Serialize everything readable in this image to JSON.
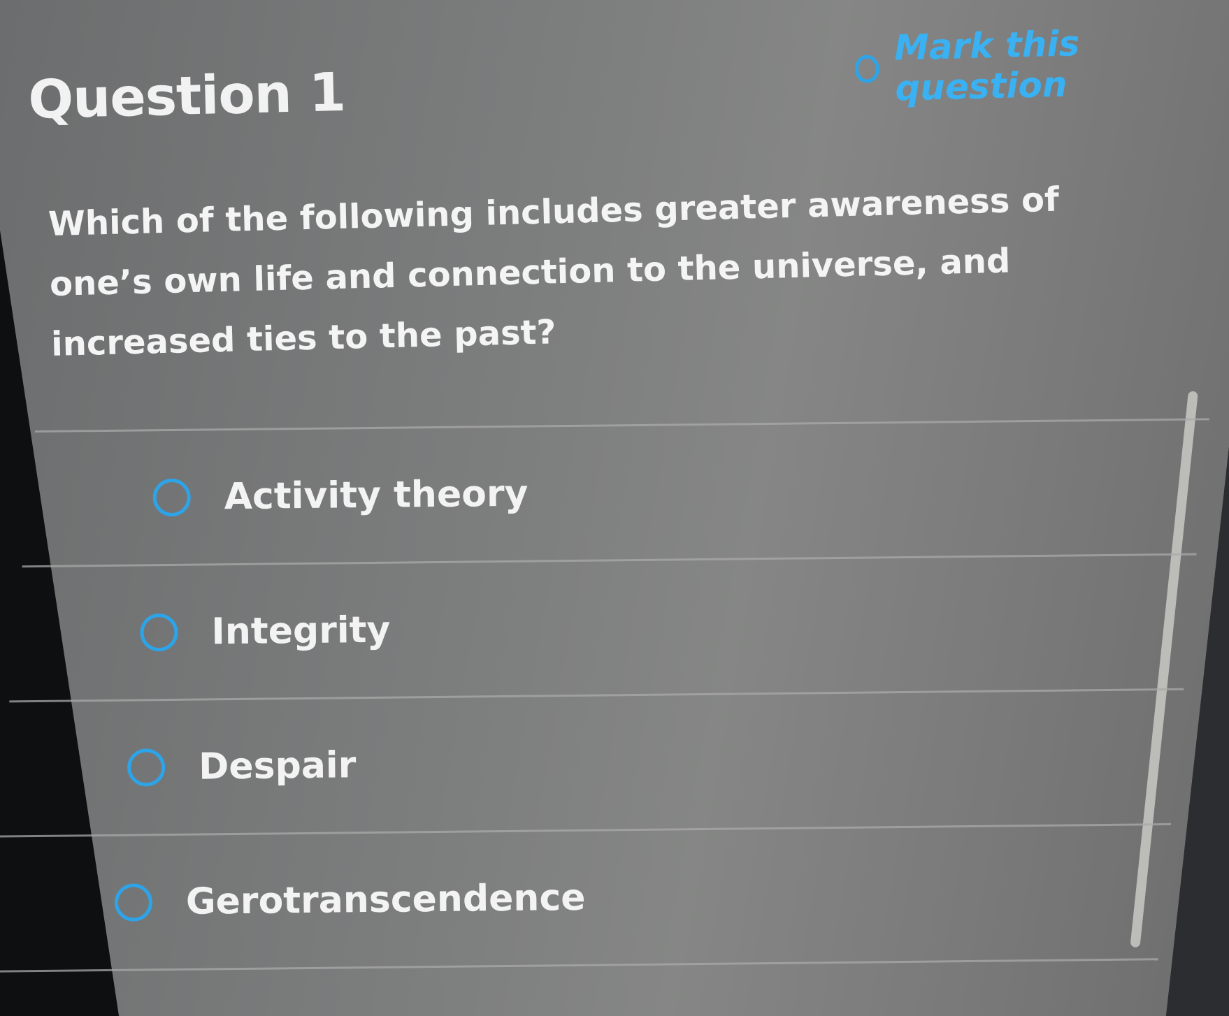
{
  "question": {
    "title": "Question 1",
    "mark_label": "Mark this question",
    "text": "Which of the following includes greater awareness of one’s own life and connection to the universe, and increased ties to the past?"
  },
  "answers": [
    {
      "label": "Activity theory"
    },
    {
      "label": "Integrity"
    },
    {
      "label": "Despair"
    },
    {
      "label": "Gerotranscendence"
    }
  ],
  "colors": {
    "accent": "#2ea4e8",
    "panel": "#7e7f7f",
    "text": "#f3f3f3"
  },
  "icons": {
    "mark": "radio-circle-icon",
    "answer": "radio-circle-icon"
  }
}
